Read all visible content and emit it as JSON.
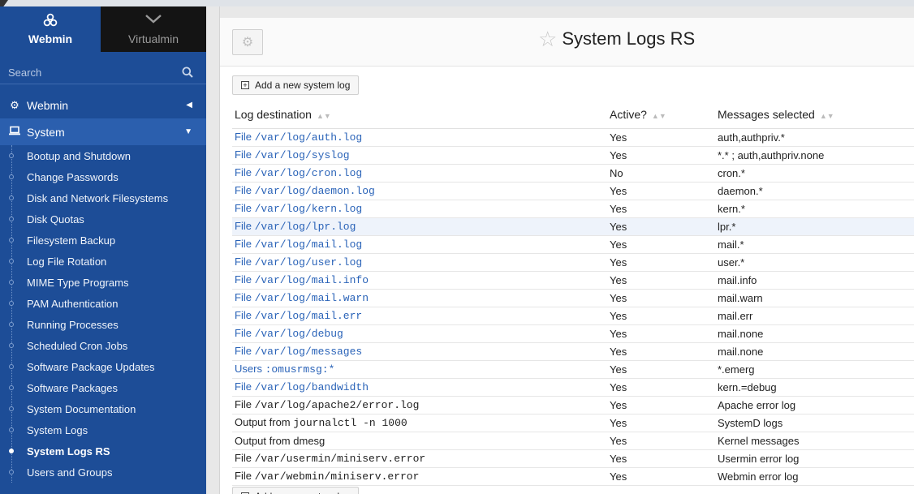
{
  "switcher": {
    "webmin": "Webmin",
    "virtualmin": "Virtualmin"
  },
  "search": {
    "placeholder": "Search"
  },
  "categories": {
    "webmin": "Webmin",
    "system": "System"
  },
  "modules": [
    "Bootup and Shutdown",
    "Change Passwords",
    "Disk and Network Filesystems",
    "Disk Quotas",
    "Filesystem Backup",
    "Log File Rotation",
    "MIME Type Programs",
    "PAM Authentication",
    "Running Processes",
    "Scheduled Cron Jobs",
    "Software Package Updates",
    "Software Packages",
    "System Documentation",
    "System Logs",
    "System Logs RS",
    "Users and Groups"
  ],
  "active_module": "System Logs RS",
  "page": {
    "title": "System Logs RS",
    "add_label": "Add a new system log"
  },
  "table": {
    "headers": [
      "Log destination",
      "Active?",
      "Messages selected"
    ],
    "rows": [
      {
        "prefix": "File",
        "path": "/var/log/auth.log",
        "link": true,
        "active": "Yes",
        "messages": "auth,authpriv.*"
      },
      {
        "prefix": "File",
        "path": "/var/log/syslog",
        "link": true,
        "active": "Yes",
        "messages": "*.* ; auth,authpriv.none"
      },
      {
        "prefix": "File",
        "path": "/var/log/cron.log",
        "link": true,
        "active": "No",
        "messages": "cron.*"
      },
      {
        "prefix": "File",
        "path": "/var/log/daemon.log",
        "link": true,
        "active": "Yes",
        "messages": "daemon.*"
      },
      {
        "prefix": "File",
        "path": "/var/log/kern.log",
        "link": true,
        "active": "Yes",
        "messages": "kern.*"
      },
      {
        "prefix": "File",
        "path": "/var/log/lpr.log",
        "link": true,
        "active": "Yes",
        "messages": "lpr.*",
        "highlight": true
      },
      {
        "prefix": "File",
        "path": "/var/log/mail.log",
        "link": true,
        "active": "Yes",
        "messages": "mail.*"
      },
      {
        "prefix": "File",
        "path": "/var/log/user.log",
        "link": true,
        "active": "Yes",
        "messages": "user.*"
      },
      {
        "prefix": "File",
        "path": "/var/log/mail.info",
        "link": true,
        "active": "Yes",
        "messages": "mail.info"
      },
      {
        "prefix": "File",
        "path": "/var/log/mail.warn",
        "link": true,
        "active": "Yes",
        "messages": "mail.warn"
      },
      {
        "prefix": "File",
        "path": "/var/log/mail.err",
        "link": true,
        "active": "Yes",
        "messages": "mail.err"
      },
      {
        "prefix": "File",
        "path": "/var/log/debug",
        "link": true,
        "active": "Yes",
        "messages": "mail.none"
      },
      {
        "prefix": "File",
        "path": "/var/log/messages",
        "link": true,
        "active": "Yes",
        "messages": "mail.none"
      },
      {
        "prefix": "Users",
        "path": ":omusrmsg:*",
        "link": true,
        "active": "Yes",
        "messages": "*.emerg"
      },
      {
        "prefix": "File",
        "path": "/var/log/bandwidth",
        "link": true,
        "active": "Yes",
        "messages": "kern.=debug"
      },
      {
        "prefix": "File",
        "path": "/var/log/apache2/error.log",
        "link": false,
        "active": "Yes",
        "messages": "Apache error log"
      },
      {
        "prefix": "Output from",
        "path": "journalctl -n 1000",
        "link": false,
        "active": "Yes",
        "messages": "SystemD logs"
      },
      {
        "prefix": "Output from",
        "path": "dmesg",
        "link": false,
        "mono": false,
        "active": "Yes",
        "messages": "Kernel messages"
      },
      {
        "prefix": "File",
        "path": "/var/usermin/miniserv.error",
        "link": false,
        "active": "Yes",
        "messages": "Usermin error log"
      },
      {
        "prefix": "File",
        "path": "/var/webmin/miniserv.error",
        "link": false,
        "active": "Yes",
        "messages": "Webmin error log"
      }
    ]
  },
  "colors": {
    "sidebar": "#1d4d97",
    "link": "#2a63b8",
    "inactive": "#d9302c"
  }
}
